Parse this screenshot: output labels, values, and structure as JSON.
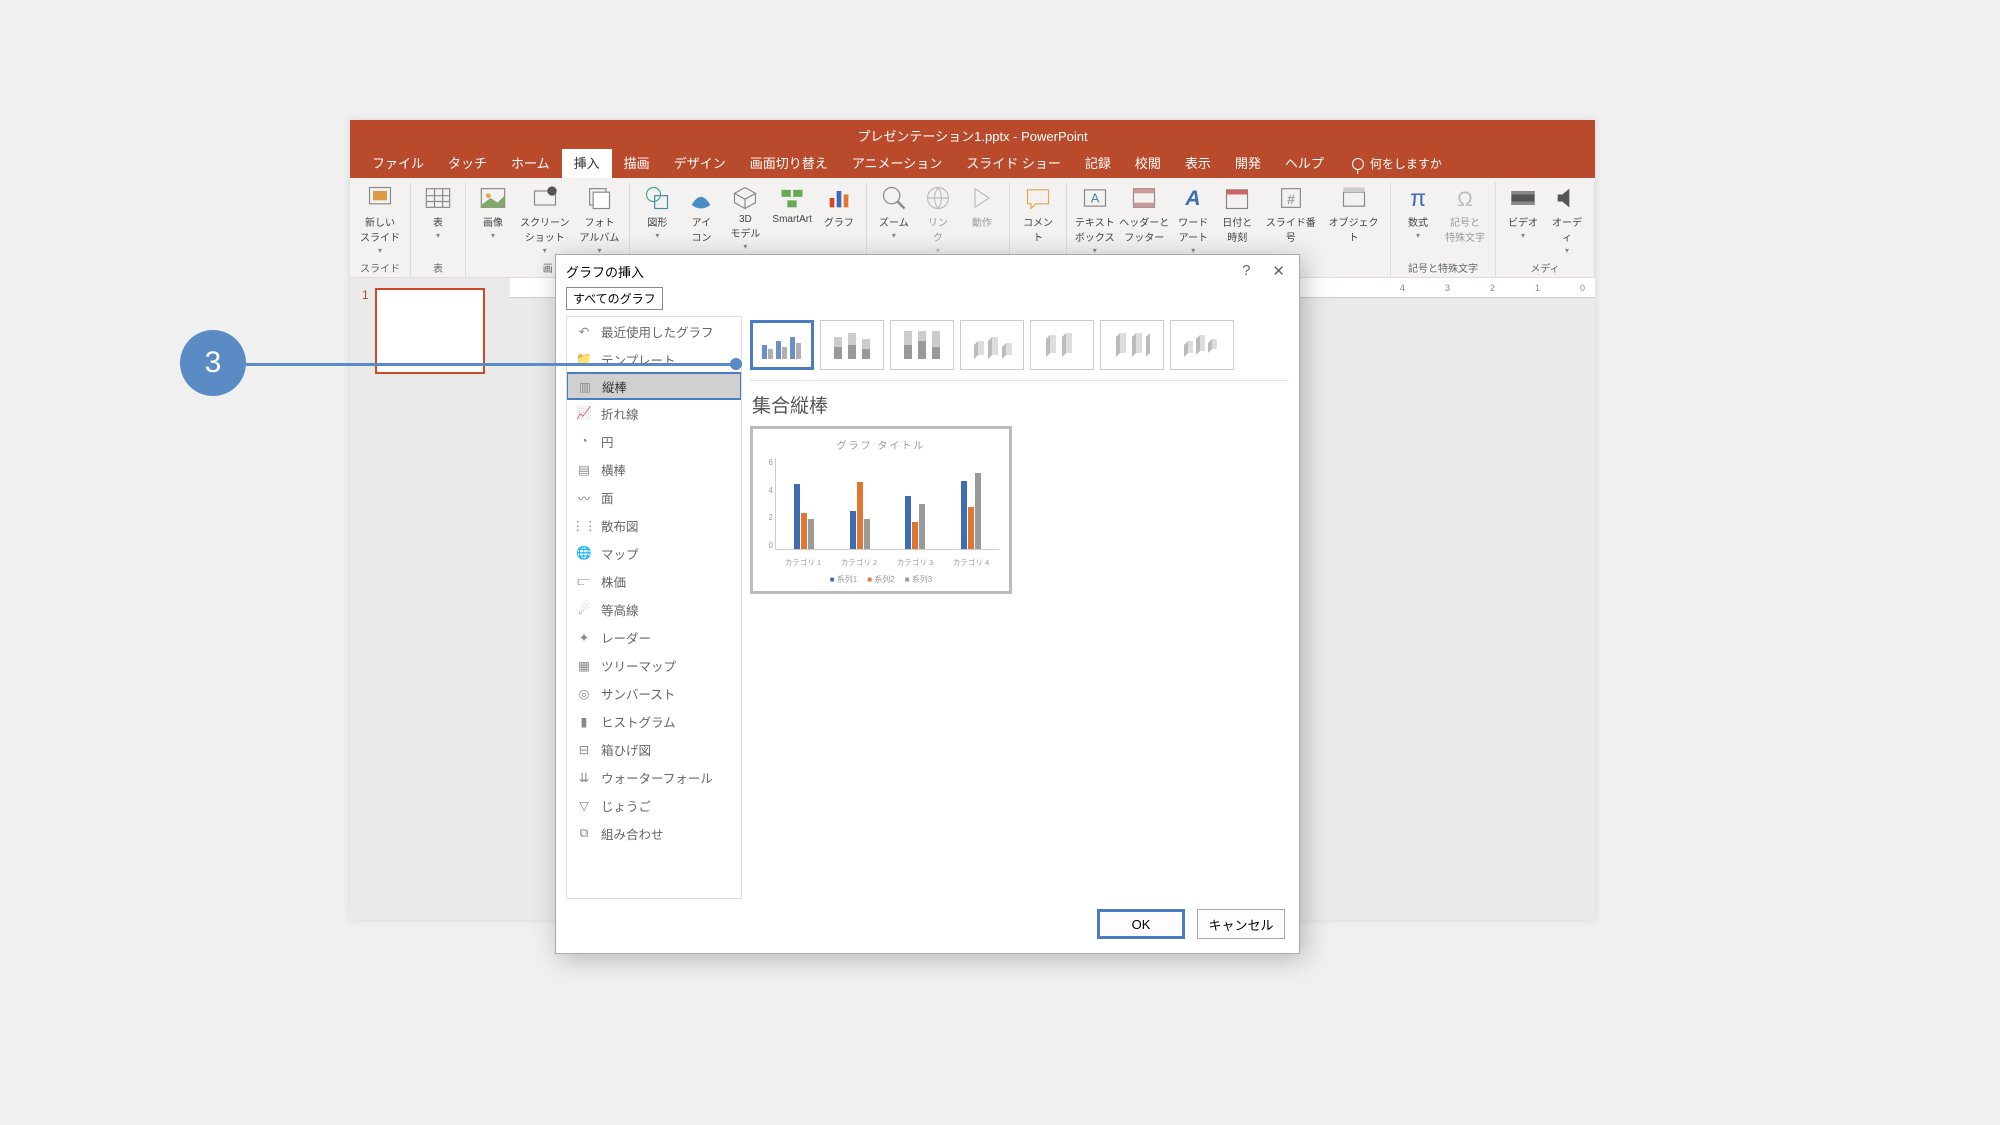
{
  "callout": "3",
  "window": {
    "title": "プレゼンテーション1.pptx - PowerPoint"
  },
  "tabs": [
    "ファイル",
    "タッチ",
    "ホーム",
    "挿入",
    "描画",
    "デザイン",
    "画面切り替え",
    "アニメーション",
    "スライド ショー",
    "記録",
    "校閲",
    "表示",
    "開発",
    "ヘルプ"
  ],
  "tell_me": "何をしますか",
  "ribbon": {
    "g1_label": "スライド",
    "new_slide": "新しい\nスライド",
    "g2_label": "表",
    "table": "表",
    "g3_label": "画",
    "image": "画像",
    "screenshot": "スクリーン\nショット",
    "album": "フォト\nアルバム",
    "shapes": "図形",
    "icons": "アイ\nコン",
    "models": "3D\nモデル",
    "smartart": "SmartArt",
    "chart": "グラフ",
    "zoom": "ズーム",
    "link": "リン\nク",
    "action": "動作",
    "comment": "コメント",
    "textbox": "テキスト\nボックス",
    "headerfooter": "ヘッダーと\nフッター",
    "wordart": "ワード\nアート",
    "datetime": "日付と\n時刻",
    "slidenum": "スライド番号",
    "object": "オブジェクト",
    "equation": "数式",
    "symbol": "記号と\n特殊文字",
    "g_sym": "記号と特殊文字",
    "video": "ビデオ",
    "audio": "オーディ",
    "g_media": "メディ"
  },
  "thumb_num": "1",
  "ruler": [
    "4",
    "3",
    "2",
    "1",
    "0"
  ],
  "dialog": {
    "title": "グラフの挿入",
    "help": "?",
    "close": "✕",
    "tab": "すべてのグラフ",
    "types": [
      {
        "icon": "↶",
        "label": "最近使用したグラフ"
      },
      {
        "icon": "📁",
        "label": "テンプレート"
      },
      {
        "icon": "▥",
        "label": "縦棒",
        "sel": true
      },
      {
        "icon": "📈",
        "label": "折れ線"
      },
      {
        "icon": "◔",
        "label": "円"
      },
      {
        "icon": "▤",
        "label": "横棒"
      },
      {
        "icon": "〰",
        "label": "面"
      },
      {
        "icon": "⋮⋮",
        "label": "散布図"
      },
      {
        "icon": "🌐",
        "label": "マップ"
      },
      {
        "icon": "⫍",
        "label": "株価"
      },
      {
        "icon": "☄",
        "label": "等高線"
      },
      {
        "icon": "✦",
        "label": "レーダー"
      },
      {
        "icon": "▦",
        "label": "ツリーマップ"
      },
      {
        "icon": "◎",
        "label": "サンバースト"
      },
      {
        "icon": "▮",
        "label": "ヒストグラム"
      },
      {
        "icon": "⊟",
        "label": "箱ひげ図"
      },
      {
        "icon": "⇊",
        "label": "ウォーターフォール"
      },
      {
        "icon": "▽",
        "label": "じょうご"
      },
      {
        "icon": "⧉",
        "label": "組み合わせ"
      }
    ],
    "chart_name": "集合縦棒",
    "ok": "OK",
    "cancel": "キャンセル",
    "preview_title": "グラフ タイトル"
  },
  "chart_data": {
    "type": "bar",
    "title": "グラフ タイトル",
    "categories": [
      "カテゴリ 1",
      "カテゴリ 2",
      "カテゴリ 3",
      "カテゴリ 4"
    ],
    "series": [
      {
        "name": "系列1",
        "values": [
          4.3,
          2.5,
          3.5,
          4.5
        ],
        "color": "#3e6db5"
      },
      {
        "name": "系列2",
        "values": [
          2.4,
          4.4,
          1.8,
          2.8
        ],
        "color": "#e0762f"
      },
      {
        "name": "系列3",
        "values": [
          2.0,
          2.0,
          3.0,
          5.0
        ],
        "color": "#9a9a9a"
      }
    ],
    "ylim": [
      0,
      6
    ],
    "yticks": [
      0,
      2,
      4,
      6
    ]
  }
}
